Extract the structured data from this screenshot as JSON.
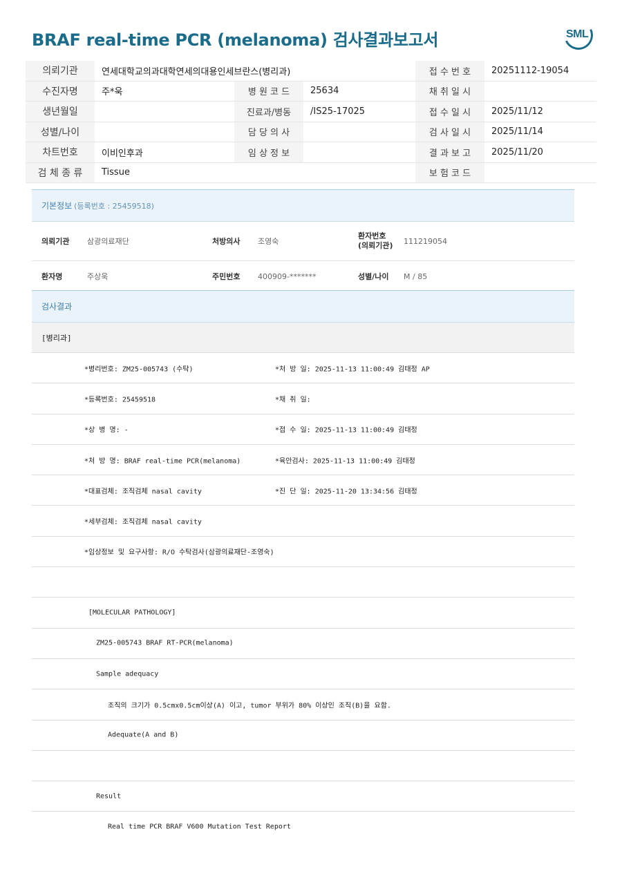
{
  "title": "BRAF real-time PCR (melanoma) 검사결과보고서",
  "logo_text": "SML",
  "header": {
    "rows": [
      {
        "l1": "의뢰기관",
        "v1": "연세대학교의과대학연세의대용인세브란스(병리과)",
        "l2": "",
        "v2": "",
        "l3": "접 수 번 호",
        "v3": "20251112-19054"
      },
      {
        "l1": "수진자명",
        "v1": "주*욱",
        "l2": "병 원 코 드",
        "v2": "25634",
        "l3": "채 취 일 시",
        "v3": ""
      },
      {
        "l1": "생년월일",
        "v1": "",
        "l2": "진료과/병동",
        "v2": "/IS25-17025",
        "l3": "접 수 일 시",
        "v3": "2025/11/12"
      },
      {
        "l1": "성별/나이",
        "v1": "",
        "l2": "담 당 의 사",
        "v2": "",
        "l3": "검 사 일 시",
        "v3": "2025/11/14"
      },
      {
        "l1": "차트번호",
        "v1": "이비인후과",
        "l2": "임 상 정 보",
        "v2": "",
        "l3": "결 과 보 고",
        "v3": "2025/11/20"
      },
      {
        "l1": "검 체 종 류",
        "v1": "Tissue",
        "l2": "",
        "v2": "",
        "l3": "보 험 코 드",
        "v3": ""
      }
    ]
  },
  "basic": {
    "title": "기본정보",
    "sub": "(등록번호 : 25459518)",
    "row1": {
      "k1": "의뢰기관",
      "v1": "삼광의료재단",
      "k2": "처방의사",
      "v2": "조영숙",
      "k3a": "환자번호",
      "k3b": "(의뢰기관)",
      "v3": "111219054"
    },
    "row2": {
      "k1": "환자명",
      "v1": "주상욱",
      "k2": "주민번호",
      "v2": "400909-*******",
      "k3": "성별/나이",
      "v3": "M / 85"
    }
  },
  "result": {
    "title": "검사결과",
    "dept": "[병리과]",
    "lines": [
      {
        "a": "*병리번호: ZM25-005743 (수탁)",
        "b": "*처 방 일: 2025-11-13 11:00:49  김태정 AP"
      },
      {
        "a": "*등록번호: 25459518",
        "b": "*채 취 일:"
      },
      {
        "a": "*상 병 명: -",
        "b": "*접 수 일: 2025-11-13 11:00:49  김태정"
      },
      {
        "a": "*처 방 명: BRAF real-time PCR(melanoma)",
        "b": "*육안검사: 2025-11-13 11:00:49  김태정"
      },
      {
        "a": "*대표검체: 조직검체 nasal cavity",
        "b": "*진 단 일: 2025-11-20 13:34:56  김태정"
      },
      {
        "a": "*세부검체: 조직검체 nasal cavity",
        "b": ""
      },
      {
        "a": "*임상정보 및 요구사항: R/O 수탁검사(삼광의료재단-조영숙)",
        "b": ""
      },
      {
        "a": "",
        "b": ""
      },
      {
        "a": "[MOLECULAR PATHOLOGY]",
        "b": ""
      },
      {
        "a": "ZM25-005743     BRAF RT-PCR(melanoma)",
        "b": ""
      },
      {
        "a": "Sample adequacy",
        "b": ""
      },
      {
        "a": "조직의 크기가 0.5cmx0.5cm이상(A) 이고, tumor 부위가 80% 이상인 조직(B)을 요함.",
        "b": ""
      },
      {
        "a": "Adequate(A and B)",
        "b": ""
      },
      {
        "a": "",
        "b": ""
      },
      {
        "a": "Result",
        "b": ""
      },
      {
        "a": "Real time PCR BRAF V600 Mutation Test Report",
        "b": ""
      }
    ]
  }
}
